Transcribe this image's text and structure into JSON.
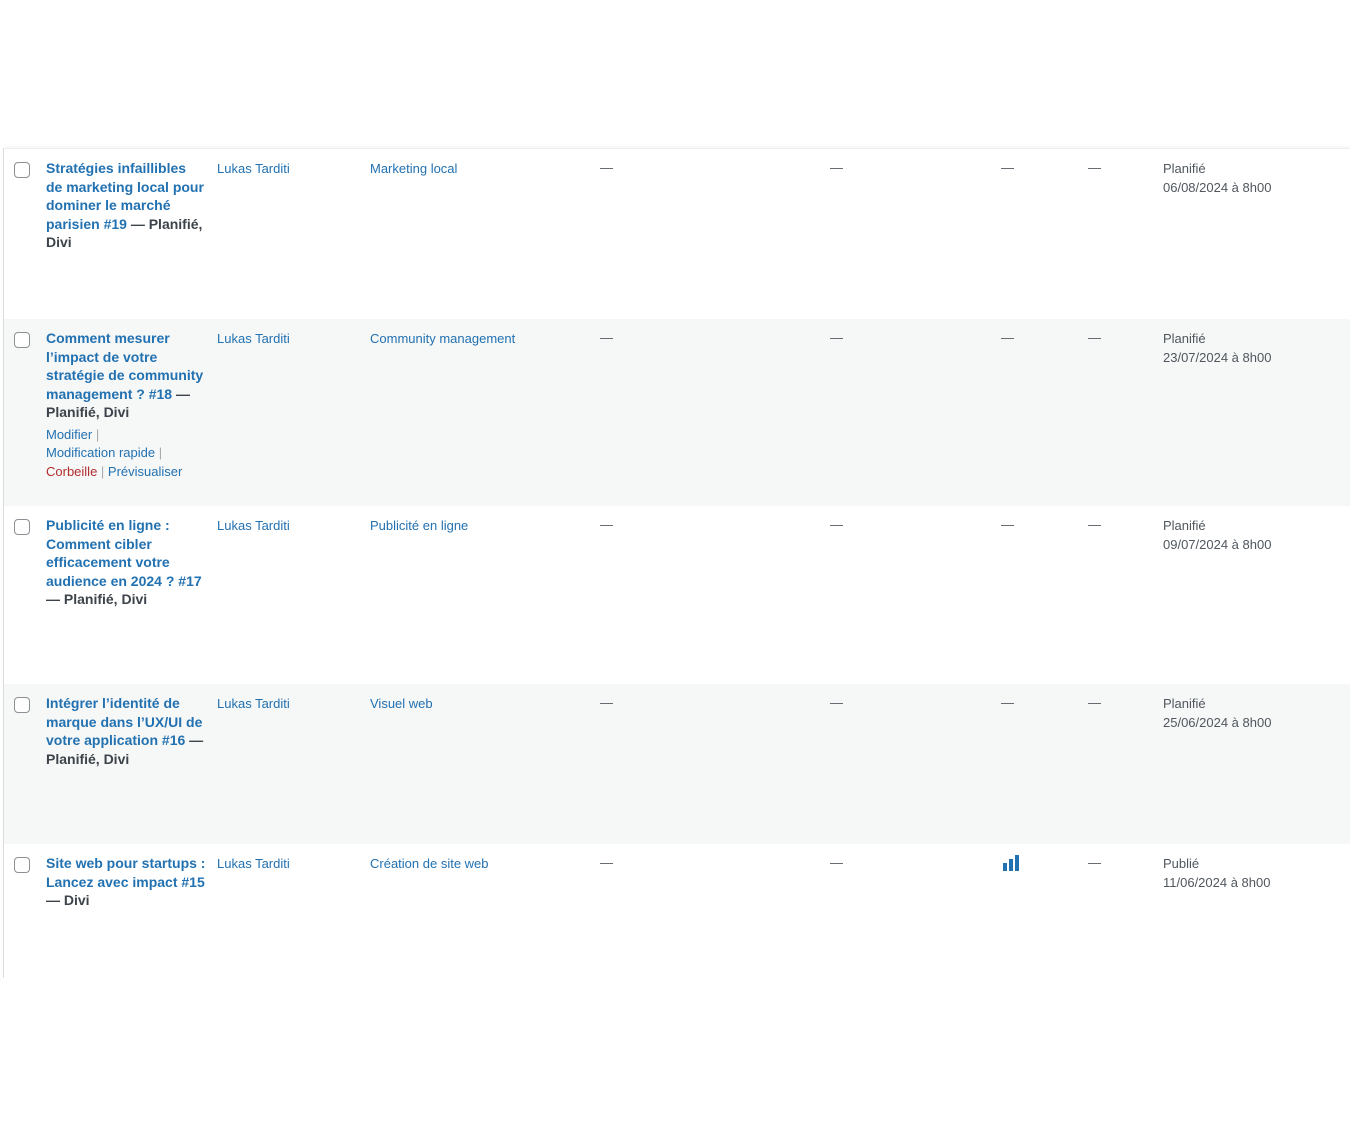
{
  "posts": [
    {
      "title": "Stratégies infaillibles de marketing local pour dominer le marché parisien #19",
      "state": " — Planifié, Divi",
      "author": "Lukas Tarditi",
      "category": "Marketing local",
      "col_tags": "—",
      "col_comments": "—",
      "col_stats": "—",
      "col_extra": "—",
      "status": "Planifié",
      "date": "06/08/2024 à 8h00"
    },
    {
      "title": "Comment mesurer l’impact de votre stratégie de community management ? #18",
      "state": " — Planifié, Divi",
      "author": "Lukas Tarditi",
      "category": "Community management",
      "col_tags": "—",
      "col_comments": "—",
      "col_stats": "—",
      "col_extra": "—",
      "status": "Planifié",
      "date": "23/07/2024 à 8h00",
      "actions": {
        "edit": "Modifier",
        "quick_edit": "Modification rapide",
        "trash": "Corbeille",
        "preview": "Prévisualiser",
        "separator": " | "
      }
    },
    {
      "title": "Publicité en ligne : Comment cibler efficacement votre audience en 2024 ? #17",
      "state": " — Planifié, Divi",
      "author": "Lukas Tarditi",
      "category": "Publicité en ligne",
      "col_tags": "—",
      "col_comments": "—",
      "col_stats": "—",
      "col_extra": "—",
      "status": "Planifié",
      "date": "09/07/2024 à 8h00"
    },
    {
      "title": "Intégrer l’identité de marque dans l’UX/UI de votre application #16",
      "state": " — Planifié, Divi",
      "author": "Lukas Tarditi",
      "category": "Visuel web",
      "col_tags": "—",
      "col_comments": "—",
      "col_stats": "—",
      "col_extra": "—",
      "status": "Planifié",
      "date": "25/06/2024 à 8h00"
    },
    {
      "title": "Site web pour startups : Lancez avec impact #15",
      "state": " — Divi",
      "author": "Lukas Tarditi",
      "category": "Création de site web",
      "col_tags": "—",
      "col_comments": "—",
      "col_stats_icon": "stats-bar-chart-icon",
      "col_extra": "—",
      "status": "Publié",
      "date": "11/06/2024 à 8h00"
    }
  ],
  "colors": {
    "link": "#2271b1",
    "trash": "#b32d2e",
    "alt_row": "#f6f7f7",
    "text": "#3c434a"
  }
}
